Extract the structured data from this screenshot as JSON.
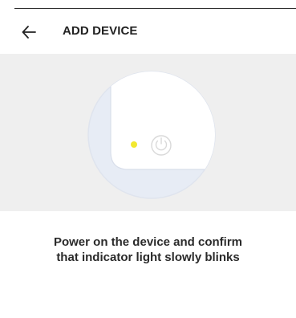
{
  "header": {
    "title": "ADD DEVICE",
    "back_icon": "arrow-left-icon"
  },
  "illustration": {
    "indicator_color": "#f2e830",
    "power_icon": "power-icon"
  },
  "instruction": {
    "line1": "Power on the device and confirm",
    "line2": "that indicator light slowly blinks"
  }
}
